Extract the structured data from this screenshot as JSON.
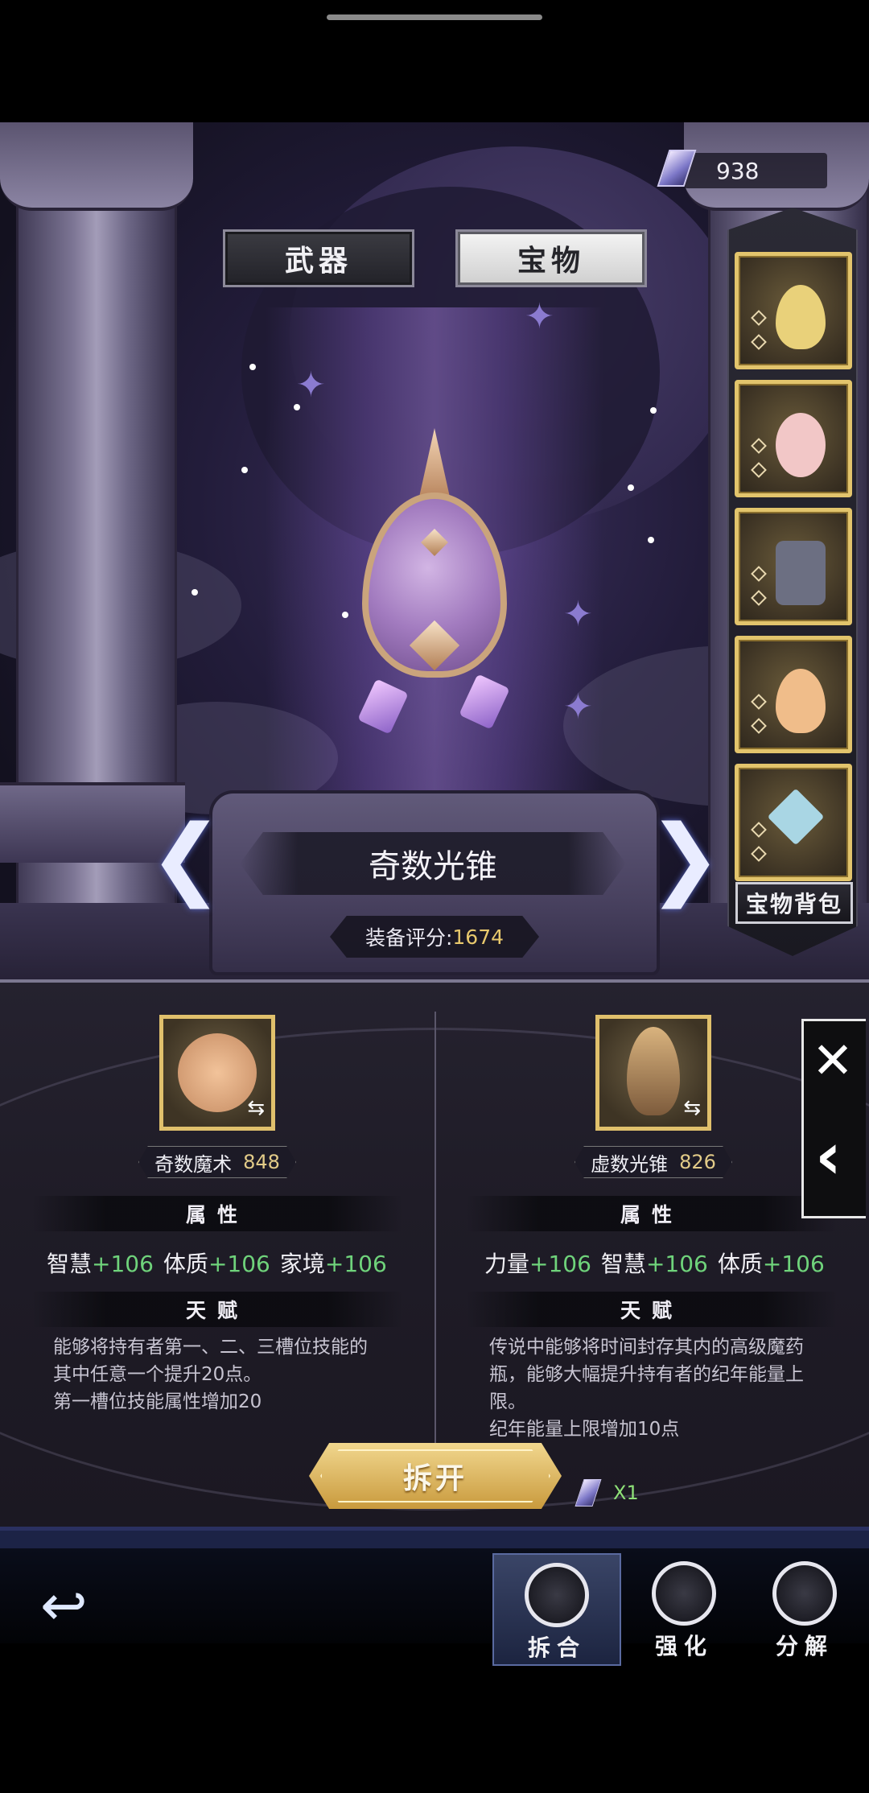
{
  "currency": {
    "amount": "938",
    "icon": "crystal-icon"
  },
  "tabs": [
    {
      "label": "武器",
      "active": false
    },
    {
      "label": "宝物",
      "active": true
    }
  ],
  "slots": [
    {
      "name": "yellow-potion-treasure",
      "color": "#e9d17a"
    },
    {
      "name": "flower-brooch-treasure",
      "color": "#f2c7c7"
    },
    {
      "name": "armored-figure-treasure",
      "color": "#6c6f82"
    },
    {
      "name": "orange-potion-treasure",
      "color": "#f0bd8a"
    },
    {
      "name": "crystal-rose-treasure",
      "color": "#a9d6e4"
    }
  ],
  "bag_button": "宝物背包",
  "item": {
    "name": "奇数光锥",
    "score_label": "装备评分:",
    "score": "1674"
  },
  "left": {
    "card_name": "奇数魔术",
    "level": "848",
    "attr_title": "属性",
    "attrs": [
      {
        "name": "智慧",
        "value": "+106"
      },
      {
        "name": "体质",
        "value": "+106"
      },
      {
        "name": "家境",
        "value": "+106"
      }
    ],
    "talent_title": "天赋",
    "talent_lines": [
      "能够将持有者第一、二、三槽位技能的",
      "其中任意一个提升20点。",
      "第一槽位技能属性增加20"
    ]
  },
  "right": {
    "card_name": "虚数光锥",
    "level": "826",
    "attr_title": "属性",
    "attrs": [
      {
        "name": "力量",
        "value": "+106"
      },
      {
        "name": "智慧",
        "value": "+106"
      },
      {
        "name": "体质",
        "value": "+106"
      }
    ],
    "talent_title": "天赋",
    "talent_lines": [
      "传说中能够将时间封存其内的高级魔药",
      "瓶，能够大幅提升持有者的纪年能量上",
      "限。",
      "纪年能量上限增加10点"
    ]
  },
  "split_button": "拆开",
  "cost": "X1",
  "nav": [
    {
      "label": "拆合",
      "active": true
    },
    {
      "label": "强化",
      "active": false
    },
    {
      "label": "分解",
      "active": false
    }
  ]
}
